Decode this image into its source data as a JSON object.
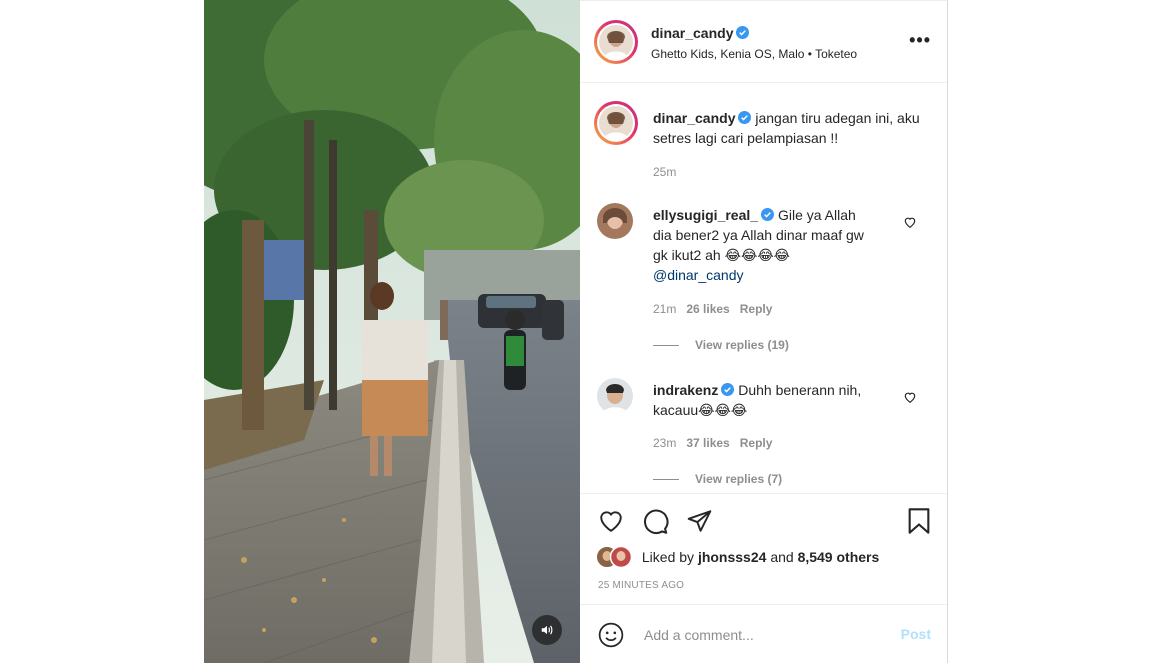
{
  "post": {
    "username": "dinar_candy",
    "location": "Ghetto Kids, Kenia OS, Malo • Toketeo",
    "more_label": "•••"
  },
  "caption": {
    "username": "dinar_candy",
    "text": "jangan tiru adegan ini, aku setres lagi cari pelampiasan !!",
    "time": "25m"
  },
  "comments": [
    {
      "username": "ellysugigi_real_",
      "text_line1": "Gile ya Allah",
      "text_line2": "dia bener2 ya Allah dinar maaf gw",
      "text_line3": "gk ikut2 ah",
      "emojis": "😂😂😂😂",
      "mention": "@dinar_candy",
      "time": "21m",
      "likes": "26 likes",
      "reply": "Reply",
      "view_replies": "View replies (19)"
    },
    {
      "username": "indrakenz",
      "text_line1": "Duhh benerann nih,",
      "text_line2": "kacauu",
      "emojis": "😂😂😂",
      "time": "23m",
      "likes": "37 likes",
      "reply": "Reply",
      "view_replies": "View replies (7)"
    }
  ],
  "likes": {
    "prefix": "Liked by",
    "user": "jhonsss24",
    "middle": "and",
    "others": "8,549 others",
    "time_ago": "25 MINUTES AGO"
  },
  "composer": {
    "placeholder": "Add a comment...",
    "post_label": "Post"
  },
  "colors": {
    "verified": "#3897f0",
    "post_disabled": "#b2dffc",
    "meta_grey": "#8e8e8e"
  },
  "icons": {
    "like": "heart-icon",
    "comment": "comment-bubble-icon",
    "share": "paper-plane-icon",
    "save": "bookmark-icon",
    "emoji": "smiley-icon",
    "audio": "speaker-icon"
  }
}
